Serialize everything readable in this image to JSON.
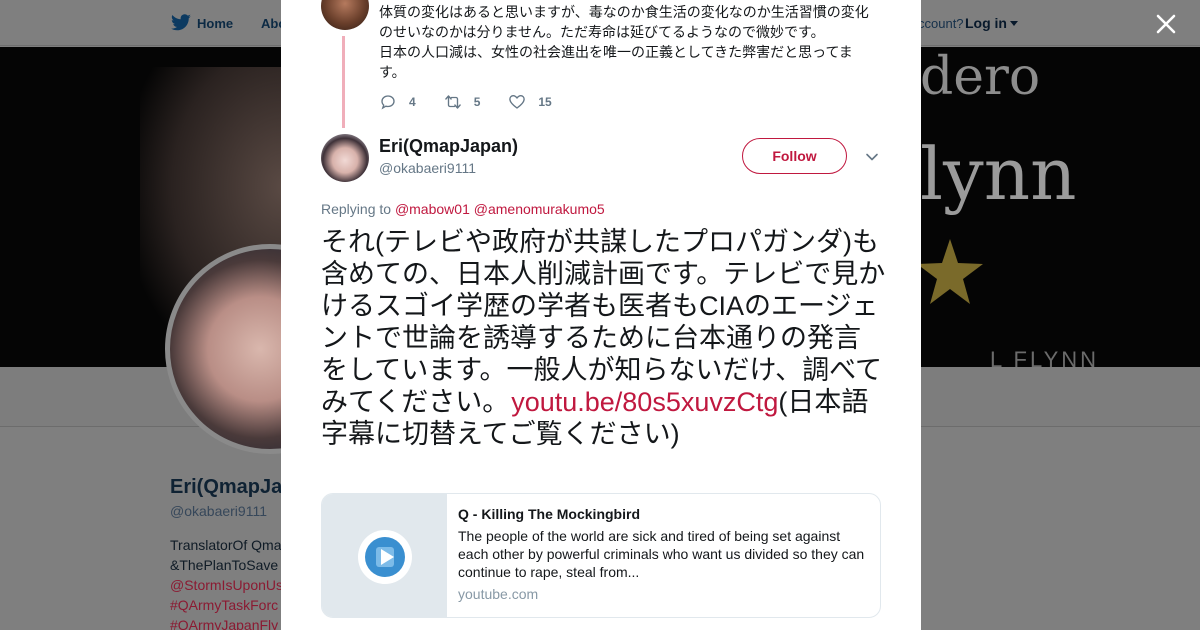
{
  "nav": {
    "home": "Home",
    "about": "Abo",
    "account_prompt": "ccount?",
    "login": "Log in"
  },
  "banner": {
    "line1": "dero",
    "line2": "lynn",
    "line3": "L FLYNN"
  },
  "background_profile": {
    "name": "Eri(QmapJa",
    "handle": "@okabaeri9111",
    "bio_lines": [
      "TranslatorOf Qma",
      "&ThePlanToSave"
    ],
    "bio_tags": [
      "@StormIsUponUs",
      "#QArmyTaskForc",
      "#QArmyJapanFly"
    ]
  },
  "previous_tweet": {
    "text": "体質の変化はあると思いますが、毒なのか食生活の変化なのか生活習慣の変化のせいなのかは分りません。ただ寿命は延びてるようなので微妙です。\n日本の人口減は、女性の社会進出を唯一の正義としてきた弊害だと思ってます。",
    "replies": "4",
    "retweets": "5",
    "likes": "15"
  },
  "tweet": {
    "author_name": "Eri(QmapJapan)",
    "author_handle": "@okabaeri9111",
    "follow_label": "Follow",
    "replying_prefix": "Replying to",
    "mention_1": "@mabow01",
    "mention_2": "@amenomurakumo5",
    "text": "それ(テレビや政府が共謀したプロパガンダ)も含めての、日本人削減計画です。テレビで見かけるスゴイ学歴の学者も医者もCIAのエージェントで世論を誘導するために台本通りの発言をしています。一般人が知らないだけ、調べてみてください。",
    "link": "youtu.be/80s5xuvzCtg",
    "text_after_link": "(日本語字幕に切替えてご覧ください)"
  },
  "card": {
    "title": "Q - Killing The Mockingbird",
    "description": "The people of the world are sick and tired of being set against each other by powerful criminals who want us divided so they can continue to rape, steal from...",
    "domain": "youtube.com"
  },
  "colors": {
    "accent": "#c0183f",
    "muted": "#657786",
    "overlay": "#7f7f7f"
  },
  "icons": [
    "twitter-bird-icon",
    "close-icon",
    "reply-icon",
    "retweet-icon",
    "like-icon",
    "chevron-down-icon",
    "play-icon",
    "star-icon"
  ]
}
